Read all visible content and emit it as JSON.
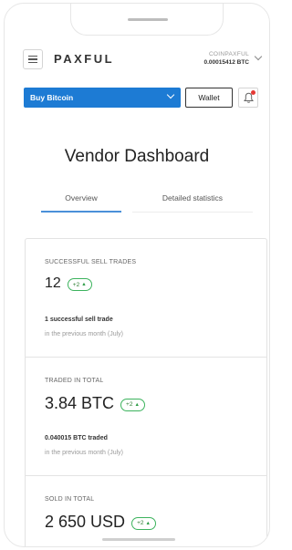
{
  "header": {
    "logo": "PAXFUL",
    "wallet_name": "COINPAXFUL",
    "wallet_balance": "0.00015412 BTC"
  },
  "actions": {
    "buy_select": "Buy Bitcoin",
    "wallet_button": "Wallet",
    "notification_dot_color": "#e53935",
    "accent_color": "#1d7bd4"
  },
  "page": {
    "title": "Vendor Dashboard"
  },
  "tabs": [
    {
      "label": "Overview",
      "active": true
    },
    {
      "label": "Detailed statistics",
      "active": false
    }
  ],
  "stats": [
    {
      "label": "SUCCESSFUL SELL TRADES",
      "value": "12",
      "badge": "+2",
      "detail": "1 successful sell trade",
      "period": "in the previous month (July)"
    },
    {
      "label": "TRADED IN TOTAL",
      "value": "3.84 BTC",
      "badge": "+2",
      "detail": "0.040015 BTC traded",
      "period": "in the previous month (July)"
    },
    {
      "label": "SOLD IN TOTAL",
      "value": "2 650 USD",
      "badge": "+2"
    }
  ]
}
